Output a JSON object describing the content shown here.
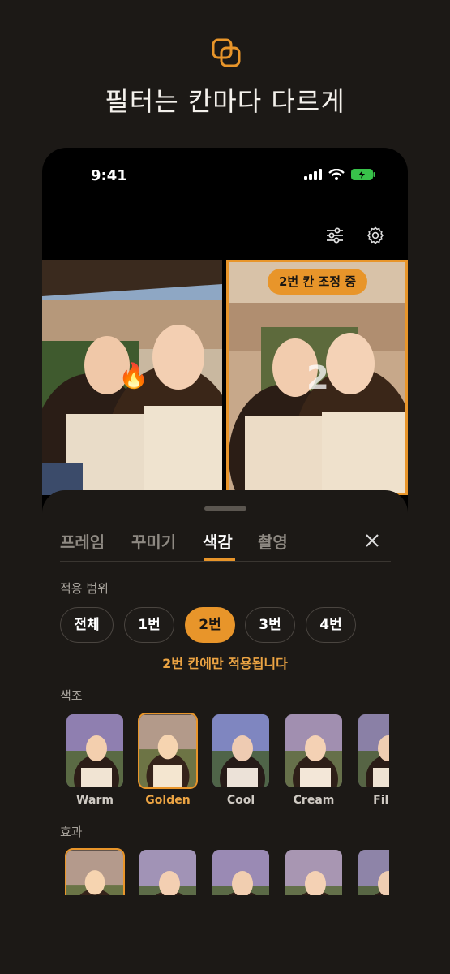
{
  "header": {
    "headline": "필터는 칸마다 다르게",
    "logo_icon": "overlapping-squares-icon",
    "accent": "#e8952a"
  },
  "phone": {
    "status": {
      "time": "9:41",
      "icons": [
        "signal-icon",
        "wifi-icon",
        "battery-charging-icon"
      ]
    },
    "toolbar": {
      "icons": [
        "sliders-icon",
        "gear-icon"
      ]
    },
    "photos": {
      "cell1": {
        "sticker": "🔥"
      },
      "cell2": {
        "badge": "2번 칸 조정 중",
        "number": "2"
      }
    }
  },
  "sheet": {
    "tabs": [
      "프레임",
      "꾸미기",
      "색감",
      "촬영"
    ],
    "active_tab": "색감",
    "apply_range_label": "적용 범위",
    "range_options": [
      "전체",
      "1번",
      "2번",
      "3번",
      "4번"
    ],
    "selected_range": "2번",
    "range_note": "2번 칸에만 적용됩니다",
    "tone_label": "색조",
    "tones": [
      "Warm",
      "Golden",
      "Cool",
      "Cream",
      "Film"
    ],
    "selected_tone": "Golden",
    "effect_label": "효과"
  }
}
